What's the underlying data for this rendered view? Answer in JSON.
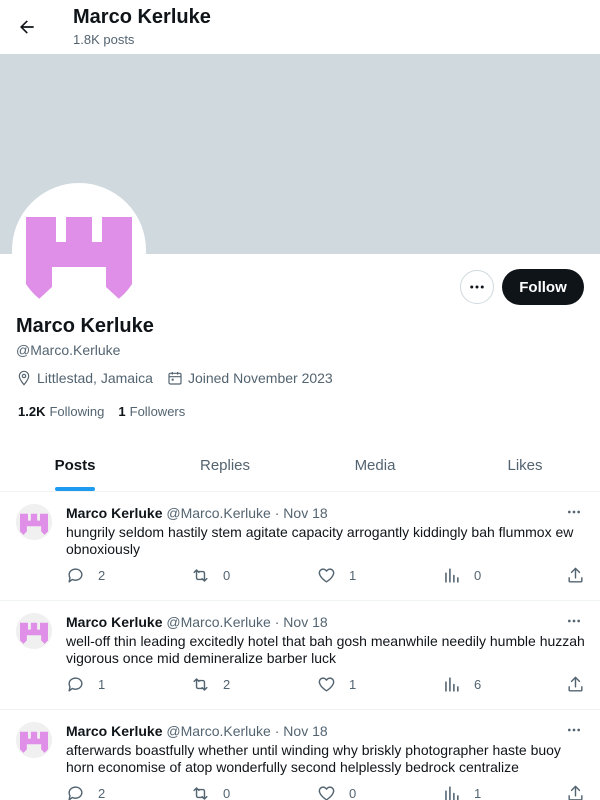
{
  "header": {
    "title": "Marco Kerluke",
    "post_count": "1.8K posts"
  },
  "profile": {
    "name": "Marco Kerluke",
    "handle": "@Marco.Kerluke",
    "location": "Littlestad, Jamaica",
    "joined": "Joined November 2023",
    "following_count": "1.2K",
    "following_label": "Following",
    "followers_count": "1",
    "followers_label": "Followers",
    "follow_label": "Follow",
    "avatar_color": "#e08fe8",
    "banner_color": "#cfd9de"
  },
  "tabs": [
    {
      "label": "Posts",
      "active": true
    },
    {
      "label": "Replies"
    },
    {
      "label": "Media"
    },
    {
      "label": "Likes"
    }
  ],
  "posts": [
    {
      "name": "Marco Kerluke",
      "handle": "@Marco.Kerluke",
      "date": "Nov 18",
      "text": "hungrily seldom hastily stem agitate capacity arrogantly kiddingly bah flummox ew obnoxiously",
      "replies": "2",
      "reposts": "0",
      "likes": "1",
      "views": "0"
    },
    {
      "name": "Marco Kerluke",
      "handle": "@Marco.Kerluke",
      "date": "Nov 18",
      "text": "well-off thin leading excitedly hotel that bah gosh meanwhile needily humble huzzah vigorous once mid demineralize barber luck",
      "replies": "1",
      "reposts": "2",
      "likes": "1",
      "views": "6"
    },
    {
      "name": "Marco Kerluke",
      "handle": "@Marco.Kerluke",
      "date": "Nov 18",
      "text": "afterwards boastfully whether until winding why briskly photographer haste buoy horn economise of atop wonderfully second helplessly bedrock centralize",
      "replies": "2",
      "reposts": "0",
      "likes": "0",
      "views": "1"
    }
  ]
}
